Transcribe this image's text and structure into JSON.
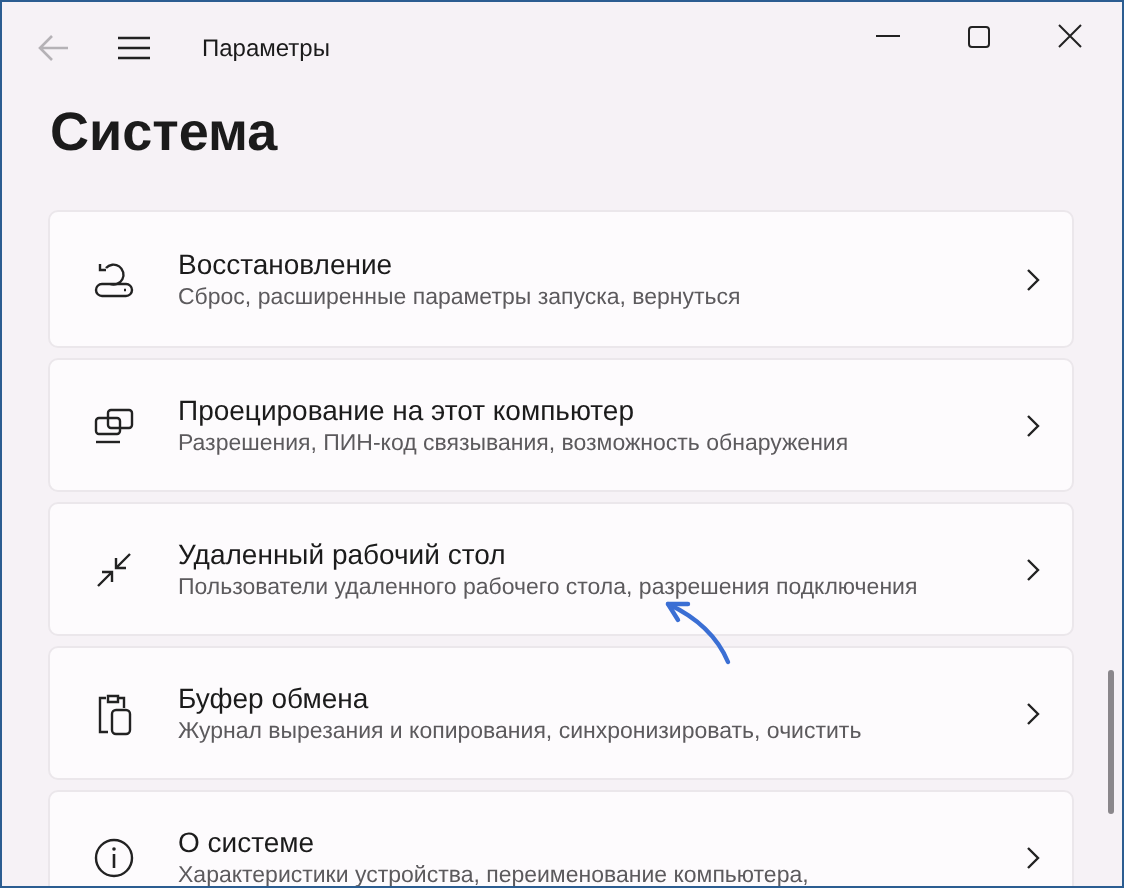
{
  "window": {
    "title": "Параметры",
    "back_disabled": true
  },
  "page_title": "Система",
  "items": [
    {
      "kind": "recovery",
      "title": "Восстановление",
      "subtitle": "Сброс, расширенные параметры запуска, вернуться"
    },
    {
      "kind": "projection",
      "title": "Проецирование на этот компьютер",
      "subtitle": "Разрешения, ПИН-код связывания, возможность обнаружения"
    },
    {
      "kind": "remote",
      "title": "Удаленный рабочий стол",
      "subtitle": "Пользователи удаленного рабочего стола, разрешения подключения"
    },
    {
      "kind": "clipboard",
      "title": "Буфер обмена",
      "subtitle": "Журнал вырезания и копирования, синхронизировать, очистить"
    },
    {
      "kind": "about",
      "title": "О системе",
      "subtitle": "Характеристики устройства, переименование компьютера,"
    }
  ]
}
